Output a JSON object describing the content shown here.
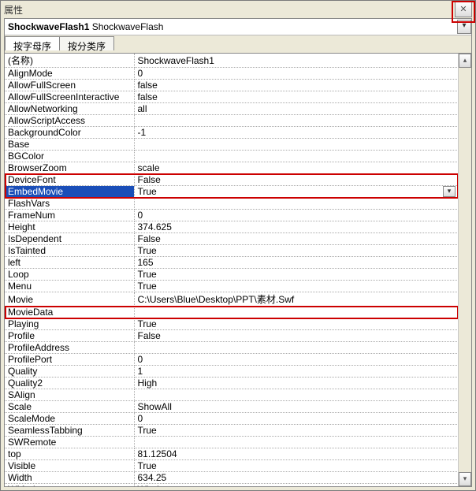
{
  "window": {
    "title": "属性"
  },
  "object": {
    "name": "ShockwaveFlash1",
    "type": " ShockwaveFlash"
  },
  "tabs": {
    "alphabetic": "按字母序",
    "categorized": "按分类序"
  },
  "selected_row": 11,
  "highlight_rows": [
    11,
    21
  ],
  "highlight_span": {
    "11": 2
  },
  "props": [
    {
      "k": "(名称)",
      "v": "ShockwaveFlash1"
    },
    {
      "k": "AlignMode",
      "v": "0"
    },
    {
      "k": "AllowFullScreen",
      "v": "false"
    },
    {
      "k": "AllowFullScreenInteractive",
      "v": "false"
    },
    {
      "k": "AllowNetworking",
      "v": "all"
    },
    {
      "k": "AllowScriptAccess",
      "v": ""
    },
    {
      "k": "BackgroundColor",
      "v": "-1"
    },
    {
      "k": "Base",
      "v": ""
    },
    {
      "k": "BGColor",
      "v": ""
    },
    {
      "k": "BrowserZoom",
      "v": "scale"
    },
    {
      "k": "DeviceFont",
      "v": "False"
    },
    {
      "k": "EmbedMovie",
      "v": "True",
      "dd": true
    },
    {
      "k": "FlashVars",
      "v": ""
    },
    {
      "k": "FrameNum",
      "v": "0"
    },
    {
      "k": "Height",
      "v": "374.625"
    },
    {
      "k": "IsDependent",
      "v": "False"
    },
    {
      "k": "IsTainted",
      "v": "True"
    },
    {
      "k": "left",
      "v": "165"
    },
    {
      "k": "Loop",
      "v": "True"
    },
    {
      "k": "Menu",
      "v": "True"
    },
    {
      "k": "Movie",
      "v": "C:\\Users\\Blue\\Desktop\\PPT\\素材.Swf"
    },
    {
      "k": "MovieData",
      "v": ""
    },
    {
      "k": "Playing",
      "v": "True"
    },
    {
      "k": "Profile",
      "v": "False"
    },
    {
      "k": "ProfileAddress",
      "v": ""
    },
    {
      "k": "ProfilePort",
      "v": "0"
    },
    {
      "k": "Quality",
      "v": "1"
    },
    {
      "k": "Quality2",
      "v": "High"
    },
    {
      "k": "SAlign",
      "v": ""
    },
    {
      "k": "Scale",
      "v": "ShowAll"
    },
    {
      "k": "ScaleMode",
      "v": "0"
    },
    {
      "k": "SeamlessTabbing",
      "v": "True"
    },
    {
      "k": "SWRemote",
      "v": ""
    },
    {
      "k": "top",
      "v": "81.12504"
    },
    {
      "k": "Visible",
      "v": "True"
    },
    {
      "k": "Width",
      "v": "634.25"
    },
    {
      "k": "WMode",
      "v": "Window"
    }
  ]
}
